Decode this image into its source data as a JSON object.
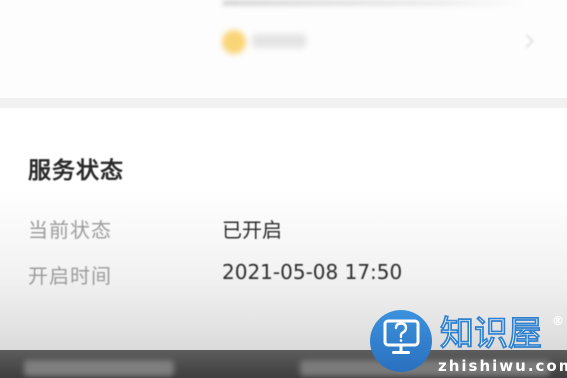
{
  "service_status": {
    "title": "服务状态",
    "rows": [
      {
        "label": "当前状态",
        "value": "已开启"
      },
      {
        "label": "开启时间",
        "value": "2021-05-08 17:50"
      }
    ]
  },
  "watermark": {
    "brand": "知识屋",
    "registered_mark": "®",
    "domain": "zhishiwu.com",
    "icon": "computer-question-icon",
    "colors": {
      "accent": "#2f80cf",
      "text": "#ffffff"
    }
  }
}
